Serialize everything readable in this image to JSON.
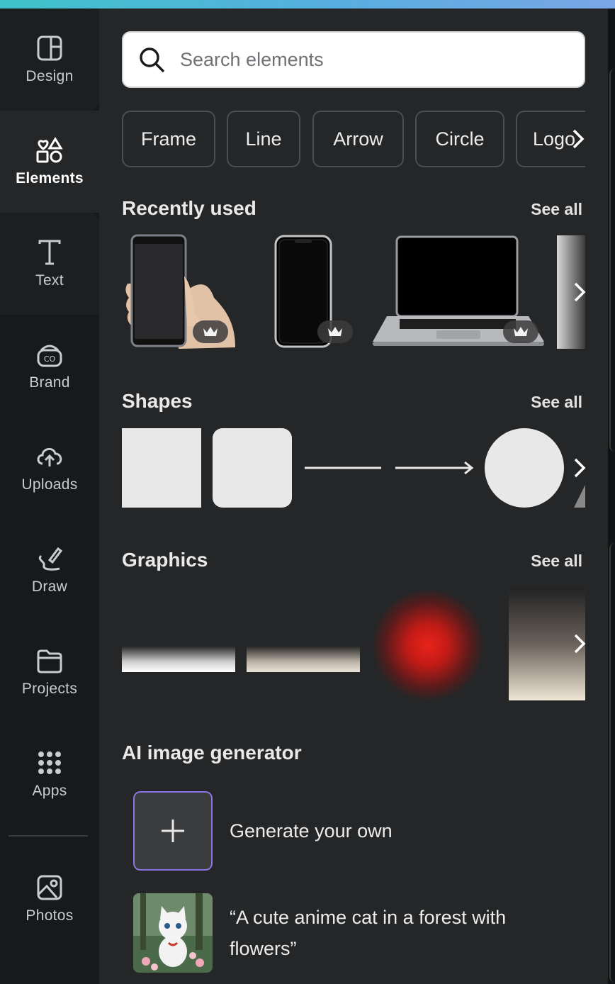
{
  "rail": {
    "items": [
      {
        "label": "Design",
        "icon": "design-icon"
      },
      {
        "label": "Elements",
        "icon": "elements-icon"
      },
      {
        "label": "Text",
        "icon": "text-icon"
      },
      {
        "label": "Brand",
        "icon": "brand-icon"
      },
      {
        "label": "Uploads",
        "icon": "uploads-icon"
      },
      {
        "label": "Draw",
        "icon": "draw-icon"
      },
      {
        "label": "Projects",
        "icon": "projects-icon"
      },
      {
        "label": "Apps",
        "icon": "apps-icon"
      },
      {
        "label": "Photos",
        "icon": "photos-icon"
      }
    ],
    "active": "Elements"
  },
  "search": {
    "placeholder": "Search elements"
  },
  "chips": [
    "Frame",
    "Line",
    "Arrow",
    "Circle",
    "Logo"
  ],
  "sections": {
    "recent": {
      "title": "Recently used",
      "see_all": "See all"
    },
    "shapes": {
      "title": "Shapes",
      "see_all": "See all"
    },
    "graphics": {
      "title": "Graphics",
      "see_all": "See all"
    },
    "ai": {
      "title": "AI image generator"
    }
  },
  "ai": {
    "generate_label": "Generate your own",
    "prompt_line1": "“A cute anime cat in a forest with",
    "prompt_line2": "flowers”"
  },
  "colors": {
    "accent_border": "#8a72e0",
    "panel_bg": "#252627",
    "rail_bg": "#18191b"
  }
}
